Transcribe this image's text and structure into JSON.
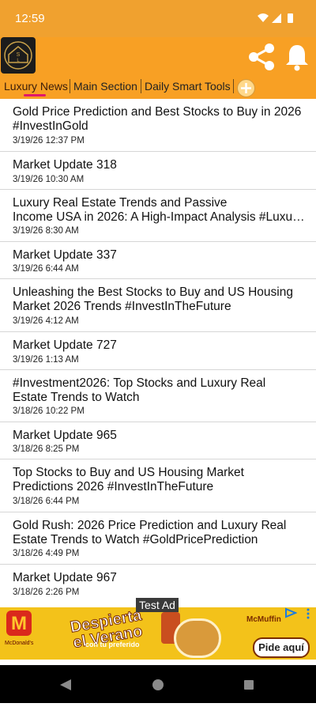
{
  "status_bar": {
    "time": "12:59"
  },
  "header": {
    "logo_letters": [
      "S",
      "L"
    ]
  },
  "tabs": [
    {
      "label": "Luxury News",
      "active": true
    },
    {
      "label": "Main Section",
      "active": false
    },
    {
      "label": "Daily Smart Tools",
      "active": false
    }
  ],
  "news": [
    {
      "title": "Gold Price Prediction and Best Stocks to Buy in 2026 #InvestInGold",
      "date": "3/19/26 12:37 PM"
    },
    {
      "title": "Market Update 318",
      "date": "3/19/26 10:30 AM"
    },
    {
      "title": "Luxury Real Estate Trends and Passive Income USA in 2026: A High-Impact Analysis #Luxu…",
      "date": "3/19/26 8:30 AM"
    },
    {
      "title": "Market Update 337",
      "date": "3/19/26 6:44 AM"
    },
    {
      "title": "Unleashing the Best Stocks to Buy and US Housing Market 2026 Trends #InvestInTheFuture",
      "date": "3/19/26 4:12 AM"
    },
    {
      "title": "Market Update 727",
      "date": "3/19/26 1:13 AM"
    },
    {
      "title": "#Investment2026: Top Stocks and Luxury Real Estate Trends to Watch",
      "date": "3/18/26 10:22 PM"
    },
    {
      "title": "Market Update 965",
      "date": "3/18/26 8:25 PM"
    },
    {
      "title": "Top Stocks to Buy and US Housing Market Predictions 2026 #InvestInTheFuture",
      "date": "3/18/26 6:44 PM"
    },
    {
      "title": "Gold Rush: 2026 Price Prediction and Luxury Real Estate Trends to Watch #GoldPricePrediction",
      "date": "3/18/26 4:49 PM"
    },
    {
      "title": "Market Update 967",
      "date": "3/18/26 2:26 PM"
    }
  ],
  "ad": {
    "label": "Test Ad",
    "brand_letter": "M",
    "brand_sub": "McDonald's",
    "headline": "Despierta el Verano",
    "subline": "con tu preferido",
    "product": "McMuffin",
    "cta": "Pide aquí"
  },
  "colors": {
    "primary": "#f8a024",
    "status_bar": "#f0a12f",
    "tab_indicator": "#e0186c"
  }
}
